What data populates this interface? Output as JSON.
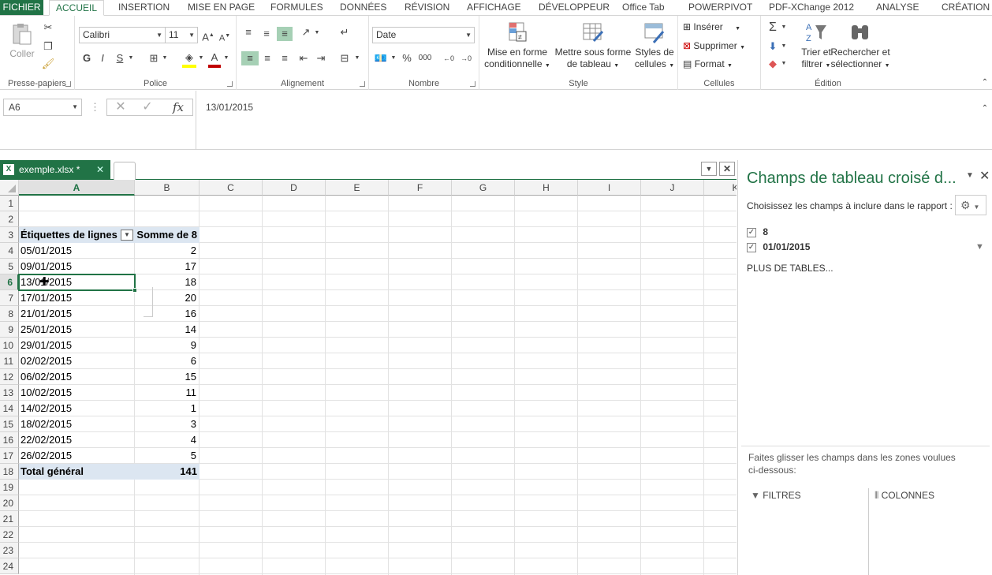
{
  "ribbon_tabs": [
    "FICHIER",
    "ACCUEIL",
    "INSERTION",
    "MISE EN PAGE",
    "FORMULES",
    "DONNÉES",
    "RÉVISION",
    "AFFICHAGE",
    "DÉVELOPPEUR",
    "Office Tab",
    "POWERPIVOT",
    "PDF-XChange 2012",
    "ANALYSE",
    "CRÉATION"
  ],
  "active_tab": "ACCUEIL",
  "clipboard": {
    "paste": "Coller",
    "label": "Presse-papiers"
  },
  "font": {
    "name": "Calibri",
    "size": "11",
    "bold": "G",
    "italic": "I",
    "underline": "S",
    "label": "Police"
  },
  "alignment": {
    "label": "Alignement"
  },
  "number": {
    "format": "Date",
    "percent": "%",
    "thousands": "000",
    "label": "Nombre"
  },
  "style": {
    "cond_format_1": "Mise en forme",
    "cond_format_2": "conditionnelle",
    "table_1": "Mettre sous forme",
    "table_2": "de tableau",
    "cell_styles_1": "Styles de",
    "cell_styles_2": "cellules",
    "label": "Style"
  },
  "cells": {
    "insert": "Insérer",
    "delete": "Supprimer",
    "format": "Format",
    "label": "Cellules"
  },
  "editing": {
    "sort_1": "Trier et",
    "sort_2": "filtrer",
    "find_1": "Rechercher et",
    "find_2": "sélectionner",
    "label": "Édition"
  },
  "formula_bar": {
    "name_box": "A6",
    "fx": "fx",
    "content": "13/01/2015"
  },
  "document_tab": {
    "name": "exemple.xlsx *"
  },
  "columns": [
    "A",
    "B",
    "C",
    "D",
    "E",
    "F",
    "G",
    "H",
    "I",
    "J",
    "K"
  ],
  "rows": [
    "1",
    "2",
    "3",
    "4",
    "5",
    "6",
    "7",
    "8",
    "9",
    "10",
    "11",
    "12",
    "13",
    "14",
    "15",
    "16",
    "17",
    "18",
    "19",
    "20",
    "21",
    "22",
    "23",
    "24"
  ],
  "pivot": {
    "header_label": "Étiquettes de lignes",
    "header_value": "Somme de 8",
    "rows": [
      {
        "date": "05/01/2015",
        "value": "2"
      },
      {
        "date": "09/01/2015",
        "value": "17"
      },
      {
        "date": "13/01/2015",
        "value": "18"
      },
      {
        "date": "17/01/2015",
        "value": "20"
      },
      {
        "date": "21/01/2015",
        "value": "16"
      },
      {
        "date": "25/01/2015",
        "value": "14"
      },
      {
        "date": "29/01/2015",
        "value": "9"
      },
      {
        "date": "02/02/2015",
        "value": "6"
      },
      {
        "date": "06/02/2015",
        "value": "15"
      },
      {
        "date": "10/02/2015",
        "value": "11"
      },
      {
        "date": "14/02/2015",
        "value": "1"
      },
      {
        "date": "18/02/2015",
        "value": "3"
      },
      {
        "date": "22/02/2015",
        "value": "4"
      },
      {
        "date": "26/02/2015",
        "value": "5"
      }
    ],
    "total_label": "Total général",
    "total_value": "141"
  },
  "field_panel": {
    "title": "Champs de tableau croisé d...",
    "subtitle": "Choisissez les champs à inclure dans le rapport :",
    "fields": [
      "8",
      "01/01/2015"
    ],
    "more_tables": "PLUS DE TABLES...",
    "drag_hint_1": "Faites glisser les champs dans les zones voulues",
    "drag_hint_2": "ci-dessous:",
    "filters": "FILTRES",
    "columns": "COLONNES"
  },
  "colors": {
    "accent": "#217346",
    "pivot_header": "#dce6f1",
    "panel_title": "#217346"
  }
}
